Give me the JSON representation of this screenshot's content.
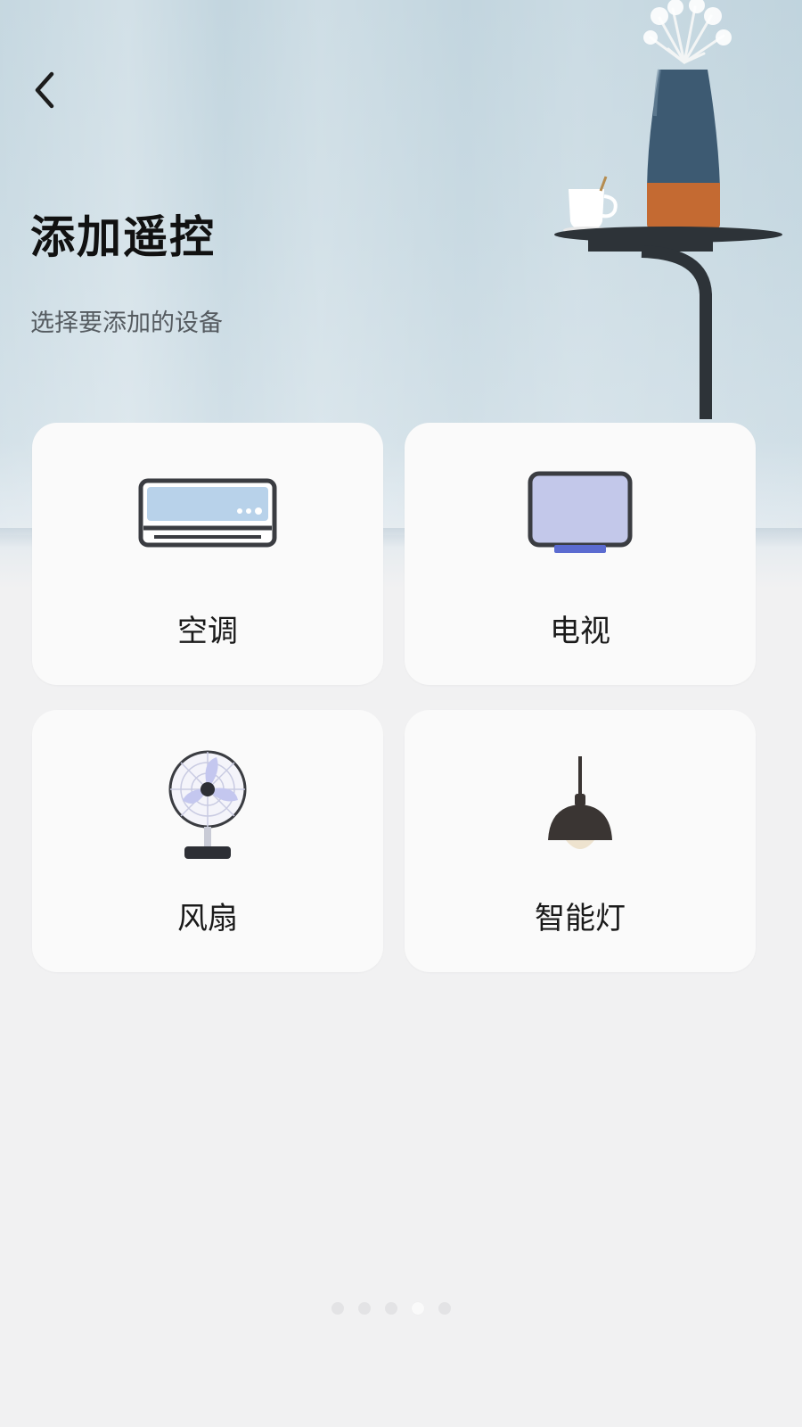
{
  "header": {
    "title": "添加遥控",
    "subtitle": "选择要添加的设备"
  },
  "devices": [
    {
      "label": "空调",
      "icon": "air-conditioner-icon"
    },
    {
      "label": "电视",
      "icon": "tv-icon"
    },
    {
      "label": "风扇",
      "icon": "fan-icon"
    },
    {
      "label": "智能灯",
      "icon": "pendant-lamp-icon"
    }
  ],
  "pager": {
    "count": 5,
    "active_index": 3
  },
  "colors": {
    "title": "#111111",
    "subtitle": "#555b60",
    "card_bg": "#fafafa",
    "page_bg": "#f1f1f2",
    "icon_stroke": "#3a3c41",
    "ac_panel": "#b8d2ea",
    "tv_screen": "#c3c8ea",
    "tv_stand": "#5b6bd0"
  }
}
